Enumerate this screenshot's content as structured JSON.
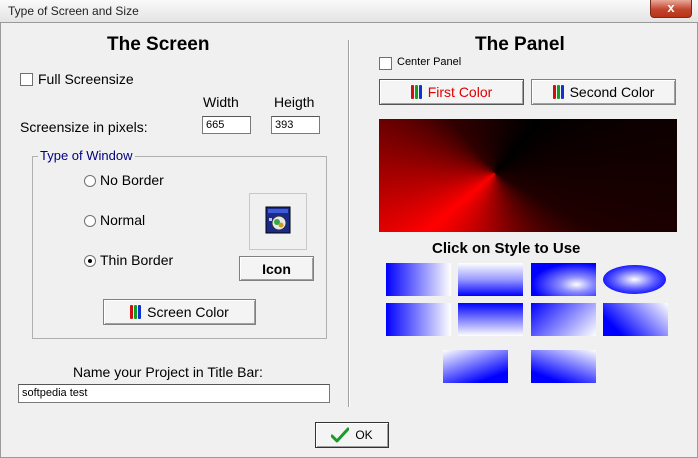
{
  "window": {
    "title": "Type of Screen and Size",
    "close_glyph": "x"
  },
  "screen": {
    "heading": "The Screen",
    "full_screensize_label": "Full Screensize",
    "width_label": "Width",
    "height_label": "Heigth",
    "size_label": "Screensize in pixels:",
    "width_value": "665",
    "height_value": "393",
    "window_type_group": "Type of Window",
    "options": [
      "No Border",
      "Normal",
      "Thin Border"
    ],
    "selected_option": "Thin Border",
    "icon_button": "Icon",
    "screen_color_button": "Screen Color",
    "project_label": "Name your Project in Title Bar:",
    "project_value": "softpedia test"
  },
  "panel": {
    "heading": "The Panel",
    "center_panel_label": "Center Panel",
    "first_color_button": "First Color",
    "second_color_button": "Second Color",
    "style_heading": "Click on Style to Use"
  },
  "ok_button": "OK",
  "colors": {
    "first_color": "#ff0000",
    "second_color": "#000000",
    "style_blue": "#0000ff"
  },
  "icons": [
    "palette-bars-icon",
    "checkmark-icon",
    "app-icon"
  ]
}
